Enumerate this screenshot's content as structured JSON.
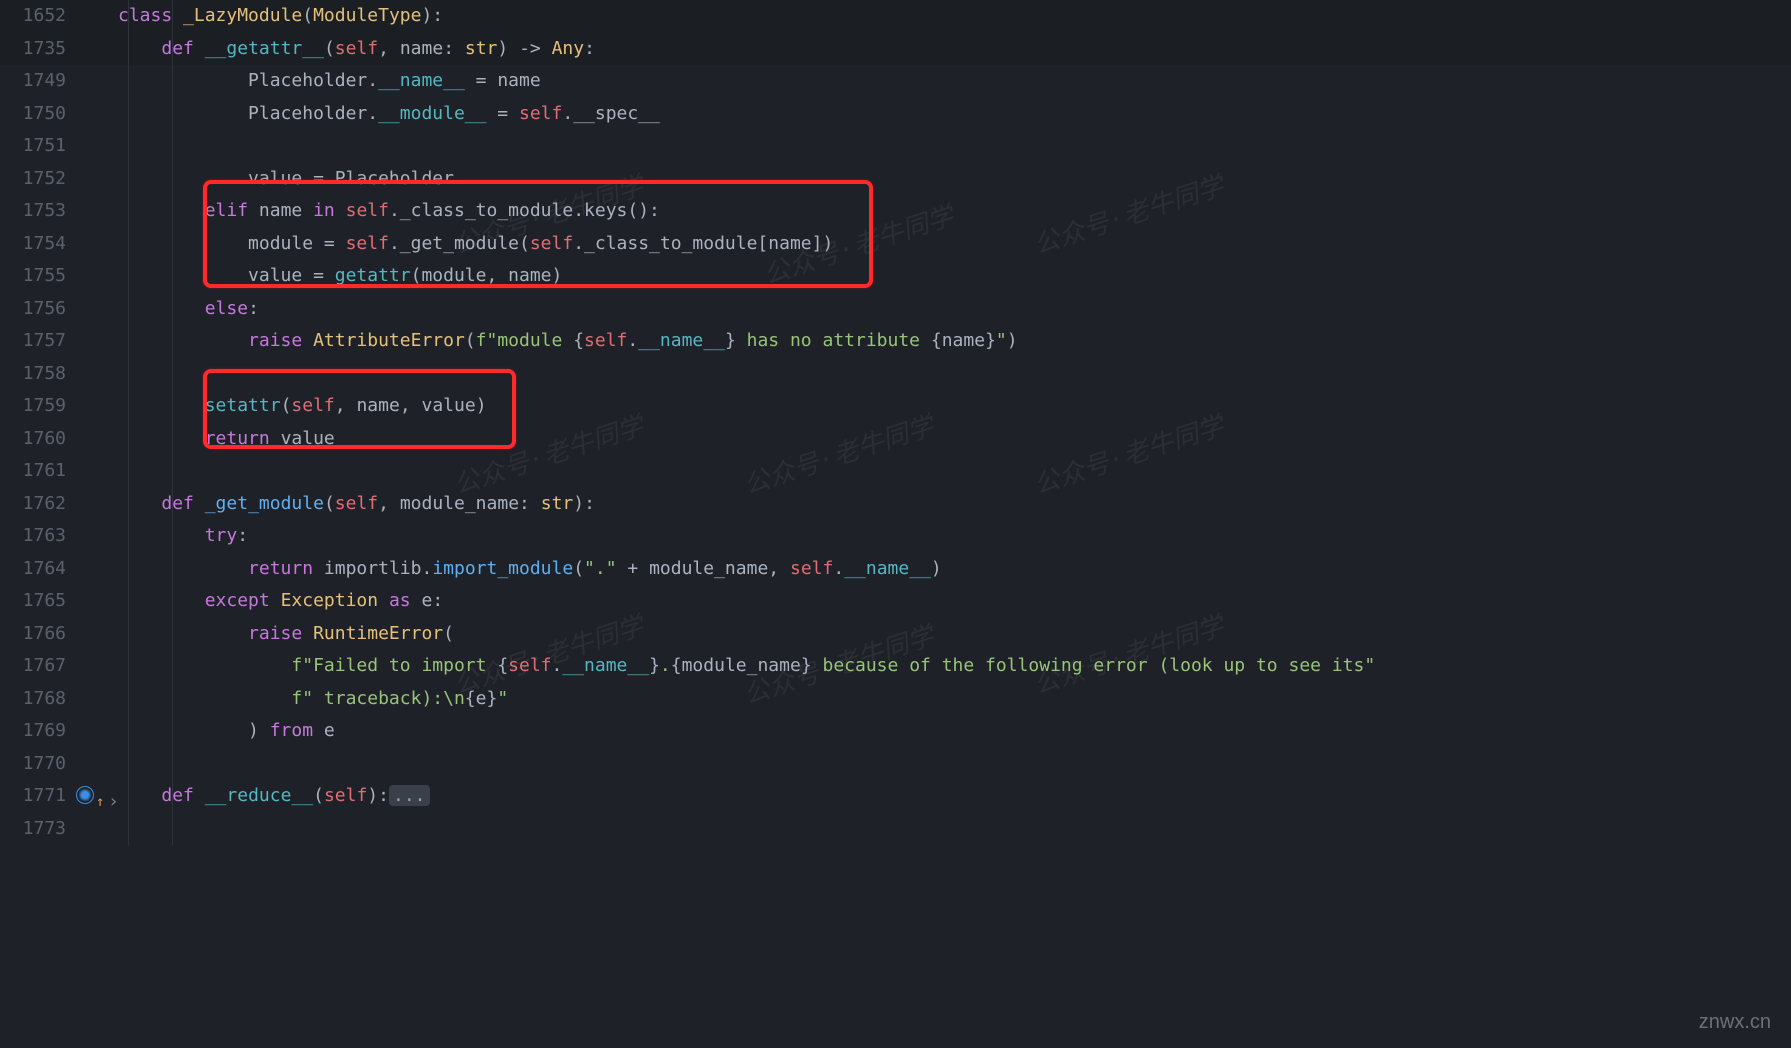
{
  "line_numbers": [
    "1652",
    "1735",
    "1749",
    "1750",
    "1751",
    "1752",
    "1753",
    "1754",
    "1755",
    "1756",
    "1757",
    "1758",
    "1759",
    "1760",
    "1761",
    "1762",
    "1763",
    "1764",
    "1765",
    "1766",
    "1767",
    "1768",
    "1769",
    "1770",
    "1771",
    "1773"
  ],
  "code": {
    "l1652": {
      "kw_class": "class",
      "cls": "_LazyModule",
      "open": "(",
      "base": "ModuleType",
      "close": "):"
    },
    "l1735": {
      "kw_def": "def ",
      "fn": "__getattr__",
      "open": "(",
      "self": "self",
      "comma1": ", ",
      "param": "name",
      "colon_t": ": ",
      "type": "str",
      "close": ") -> ",
      "ret": "Any",
      "end": ":"
    },
    "l1749": {
      "pre": "            Placeholder.",
      "mg": "__name__",
      "mid": " = ",
      "rhs": "name"
    },
    "l1750": {
      "pre": "            Placeholder.",
      "mg": "__module__",
      "mid": " = ",
      "self": "self",
      "dot": ".",
      "rhs": "__spec__"
    },
    "l1751": "",
    "l1752": {
      "pre": "            ",
      "lhs": "value",
      "mid": " = ",
      "rhs": "Placeholder"
    },
    "l1753": {
      "pre": "        ",
      "kw": "elif",
      "mid": " name ",
      "kw2": "in ",
      "self": "self",
      "rest": "._class_to_module.keys():"
    },
    "l1754": {
      "pre": "            ",
      "lhs": "module",
      "mid": " = ",
      "self": "self",
      "call": "._get_module(",
      "self2": "self",
      "rest": "._class_to_module[name])"
    },
    "l1755": {
      "pre": "            ",
      "lhs": "value",
      "mid": " = ",
      "fn": "getattr",
      "open": "(",
      "a": "module",
      "comma": ", ",
      "b": "name",
      "close": ")"
    },
    "l1756": {
      "pre": "        ",
      "kw": "else",
      "colon": ":"
    },
    "l1757": {
      "pre": "            ",
      "kw": "raise",
      "sp": " ",
      "cls": "AttributeError",
      "open": "(",
      "f": "f",
      "s1": "\"module ",
      "b1": "{",
      "self": "self",
      "dot": ".",
      "mg": "__name__",
      "b2": "}",
      "s2": " has no attribute ",
      "b3": "{",
      "n": "name",
      "b4": "}",
      "s3": "\"",
      "close": ")"
    },
    "l1758": "",
    "l1759": {
      "pre": "        ",
      "fn": "setattr",
      "open": "(",
      "self": "self",
      "c1": ", ",
      "a1": "name",
      "c2": ", ",
      "a2": "value",
      "close": ")"
    },
    "l1760": {
      "pre": "        ",
      "kw": "return",
      "sp": " ",
      "v": "value"
    },
    "l1761": "",
    "l1762": {
      "pre": "    ",
      "kw": "def ",
      "fn": "_get_module",
      "open": "(",
      "self": "self",
      "c": ", ",
      "p": "module_name",
      "ct": ": ",
      "t": "str",
      "close": "):"
    },
    "l1763": {
      "pre": "        ",
      "kw": "try",
      "colon": ":"
    },
    "l1764": {
      "pre": "            ",
      "kw": "return",
      "sp": " ",
      "mod": "importlib",
      "dot": ".",
      "fn": "import_module",
      "open": "(",
      "s": "\".\"",
      "plus": " + ",
      "a": "module_name",
      "c": ", ",
      "self": "self",
      "d2": ".",
      "mg": "__name__",
      "close": ")"
    },
    "l1765": {
      "pre": "        ",
      "kw": "except",
      "sp": " ",
      "cls": "Exception",
      "sp2": " ",
      "kw2": "as",
      "sp3": " ",
      "v": "e",
      "colon": ":"
    },
    "l1766": {
      "pre": "            ",
      "kw": "raise",
      "sp": " ",
      "cls": "RuntimeError",
      "open": "("
    },
    "l1767": {
      "pre": "                ",
      "f": "f",
      "s1": "\"Failed to import ",
      "b1": "{",
      "self": "self",
      "dot": ".",
      "mg": "__name__",
      "b2": "}",
      "s2": ".",
      "b3": "{",
      "m": "module_name",
      "b4": "}",
      "s3": " because of the following error (look up to see its\""
    },
    "l1768": {
      "pre": "                ",
      "f": "f",
      "s": "\" traceback):\\n",
      "b1": "{",
      "e": "e",
      "b2": "}",
      "s2": "\""
    },
    "l1769": {
      "pre": "            ) ",
      "kw": "from",
      "sp": " ",
      "v": "e"
    },
    "l1770": "",
    "l1771": {
      "pre": "    ",
      "kw": "def ",
      "fn": "__reduce__",
      "open": "(",
      "self": "self",
      "close": "):",
      "fold": "..."
    },
    "l1773": ""
  },
  "watermark": "公众号·老牛同学",
  "footer": "znwx.cn",
  "annotations": {
    "box1": {
      "top_line": "1753",
      "bottom_line": "1755"
    },
    "box2": {
      "top_line": "1759",
      "bottom_line": "1760"
    }
  }
}
